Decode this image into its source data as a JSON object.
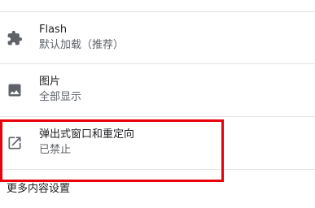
{
  "settings": {
    "items": [
      {
        "title": "Flash",
        "subtitle": "默认加载（推荐）",
        "icon": "puzzle-piece-icon"
      },
      {
        "title": "图片",
        "subtitle": "全部显示",
        "icon": "image-icon"
      },
      {
        "title": "弹出式窗口和重定向",
        "subtitle": "已禁止",
        "icon": "open-in-new-icon"
      }
    ],
    "more_link": "更多内容设置"
  },
  "colors": {
    "highlight": "#e8000b",
    "icon": "#5f6368",
    "primary_text": "#202124",
    "secondary_text": "#5f6368",
    "divider": "#e3e3e3"
  }
}
